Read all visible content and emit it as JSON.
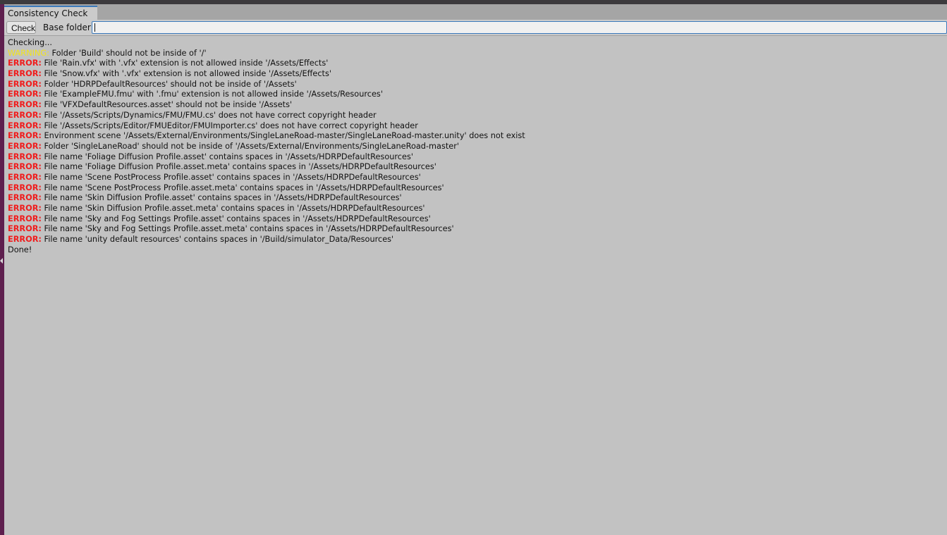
{
  "window": {
    "tab_title": "Consistency Check"
  },
  "toolbar": {
    "check_label": "Check",
    "base_folder_label": "Base folder:",
    "base_folder_value": ""
  },
  "log": {
    "header": "Checking...",
    "footer": "Done!",
    "entries": [
      {
        "level": "WARNING:",
        "message": " Folder 'Build' should not be inside of '/'"
      },
      {
        "level": "ERROR:",
        "message": " File 'Rain.vfx' with '.vfx' extension is not allowed inside '/Assets/Effects'"
      },
      {
        "level": "ERROR:",
        "message": " File 'Snow.vfx' with '.vfx' extension is not allowed inside '/Assets/Effects'"
      },
      {
        "level": "ERROR:",
        "message": " Folder 'HDRPDefaultResources' should not be inside of '/Assets'"
      },
      {
        "level": "ERROR:",
        "message": " File 'ExampleFMU.fmu' with '.fmu' extension is not allowed inside '/Assets/Resources'"
      },
      {
        "level": "ERROR:",
        "message": " File 'VFXDefaultResources.asset' should not be inside '/Assets'"
      },
      {
        "level": "ERROR:",
        "message": " File '/Assets/Scripts/Dynamics/FMU/FMU.cs' does not have correct copyright header"
      },
      {
        "level": "ERROR:",
        "message": " File '/Assets/Scripts/Editor/FMUEditor/FMUImporter.cs' does not have correct copyright header"
      },
      {
        "level": "ERROR:",
        "message": " Environment scene '/Assets/External/Environments/SingleLaneRoad-master/SingleLaneRoad-master.unity' does not exist"
      },
      {
        "level": "ERROR:",
        "message": " Folder 'SingleLaneRoad' should not be inside of '/Assets/External/Environments/SingleLaneRoad-master'"
      },
      {
        "level": "ERROR:",
        "message": " File name 'Foliage Diffusion Profile.asset' contains spaces in '/Assets/HDRPDefaultResources'"
      },
      {
        "level": "ERROR:",
        "message": " File name 'Foliage Diffusion Profile.asset.meta' contains spaces in '/Assets/HDRPDefaultResources'"
      },
      {
        "level": "ERROR:",
        "message": " File name 'Scene PostProcess Profile.asset' contains spaces in '/Assets/HDRPDefaultResources'"
      },
      {
        "level": "ERROR:",
        "message": " File name 'Scene PostProcess Profile.asset.meta' contains spaces in '/Assets/HDRPDefaultResources'"
      },
      {
        "level": "ERROR:",
        "message": " File name 'Skin Diffusion Profile.asset' contains spaces in '/Assets/HDRPDefaultResources'"
      },
      {
        "level": "ERROR:",
        "message": " File name 'Skin Diffusion Profile.asset.meta' contains spaces in '/Assets/HDRPDefaultResources'"
      },
      {
        "level": "ERROR:",
        "message": " File name 'Sky and Fog Settings Profile.asset' contains spaces in '/Assets/HDRPDefaultResources'"
      },
      {
        "level": "ERROR:",
        "message": " File name 'Sky and Fog Settings Profile.asset.meta' contains spaces in '/Assets/HDRPDefaultResources'"
      },
      {
        "level": "ERROR:",
        "message": " File name 'unity default resources' contains spaces in '/Build/simulator_Data/Resources'"
      }
    ]
  },
  "colors": {
    "error": "#f01c1c",
    "warning": "#f2e41a",
    "background": "#c2c2c2",
    "accent": "#3a79bb"
  }
}
